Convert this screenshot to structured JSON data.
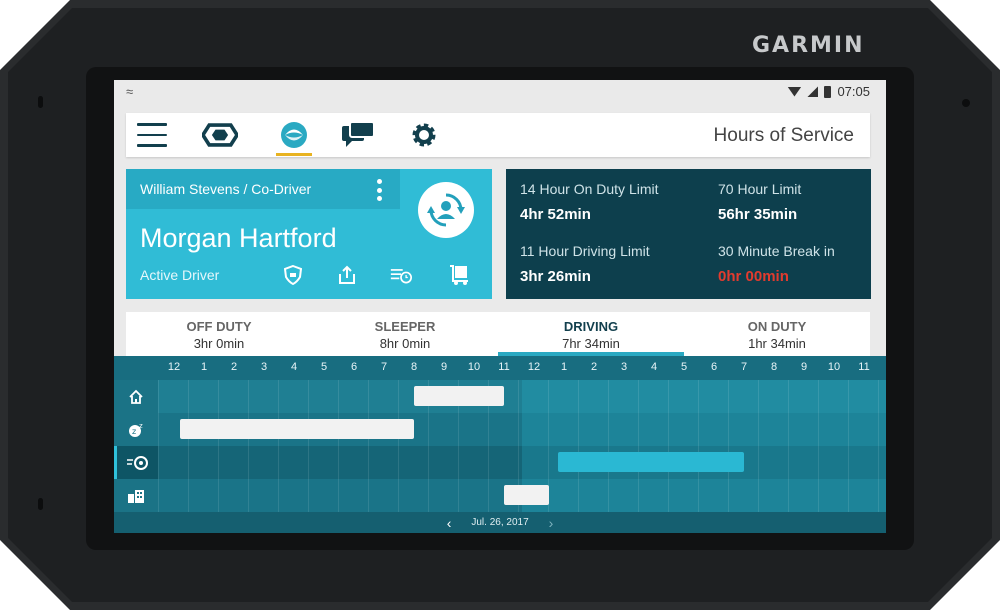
{
  "device": {
    "brand": "GARMIN"
  },
  "statusbar": {
    "time": "07:05"
  },
  "toolbar": {
    "title": "Hours of Service",
    "icons": [
      "menu-icon",
      "hexagon-nav-icon",
      "hos-swirl-icon",
      "chat-icon",
      "gear-icon"
    ],
    "active_accent": "#e8b321"
  },
  "driver_card": {
    "co_driver": "William Stevens / Co-Driver",
    "driver_name": "Morgan Hartford",
    "role": "Active Driver",
    "actions": [
      "shield-icon",
      "share-icon",
      "logs-icon",
      "cart-icon"
    ]
  },
  "limits": {
    "on_duty_label": "14 Hour On Duty Limit",
    "on_duty_value": "4hr 52min",
    "cycle_label": "70 Hour Limit",
    "cycle_value": "56hr 35min",
    "driving_label": "11 Hour Driving Limit",
    "driving_value": "3hr 26min",
    "break_label": "30 Minute Break in",
    "break_value": "0hr 00min",
    "alert_color": "#e33b2e"
  },
  "tabs": [
    {
      "name": "OFF DUTY",
      "time": "3hr 0min"
    },
    {
      "name": "SLEEPER",
      "time": "8hr 0min"
    },
    {
      "name": "DRIVING",
      "time": "7hr 34min"
    },
    {
      "name": "ON DUTY",
      "time": "1hr 34min"
    }
  ],
  "graph": {
    "hour_labels": [
      "12",
      "1",
      "2",
      "3",
      "4",
      "5",
      "6",
      "7",
      "8",
      "9",
      "10",
      "11",
      "12",
      "1",
      "2",
      "3",
      "4",
      "5",
      "6",
      "7",
      "8",
      "9",
      "10",
      "11"
    ],
    "rows": [
      {
        "status": "Off Duty",
        "icon": "home-icon"
      },
      {
        "status": "Sleeper",
        "icon": "sleep-icon"
      },
      {
        "status": "Driving",
        "icon": "steering-wheel-icon"
      },
      {
        "status": "On Duty",
        "icon": "building-icon"
      }
    ],
    "segments": [
      {
        "status": "Off Duty",
        "start_hour": 8.0,
        "end_hour": 11.0,
        "color": "#f2f2f2"
      },
      {
        "status": "Sleeper",
        "start_hour": 0.2,
        "end_hour": 8.0,
        "color": "#f2f2f2"
      },
      {
        "status": "Driving",
        "start_hour": 12.8,
        "end_hour": 19.0,
        "color": "#2ab8d3"
      },
      {
        "status": "On Duty",
        "start_hour": 11.0,
        "end_hour": 12.5,
        "color": "#f2f2f2"
      }
    ],
    "date": "Jul. 26, 2017"
  }
}
